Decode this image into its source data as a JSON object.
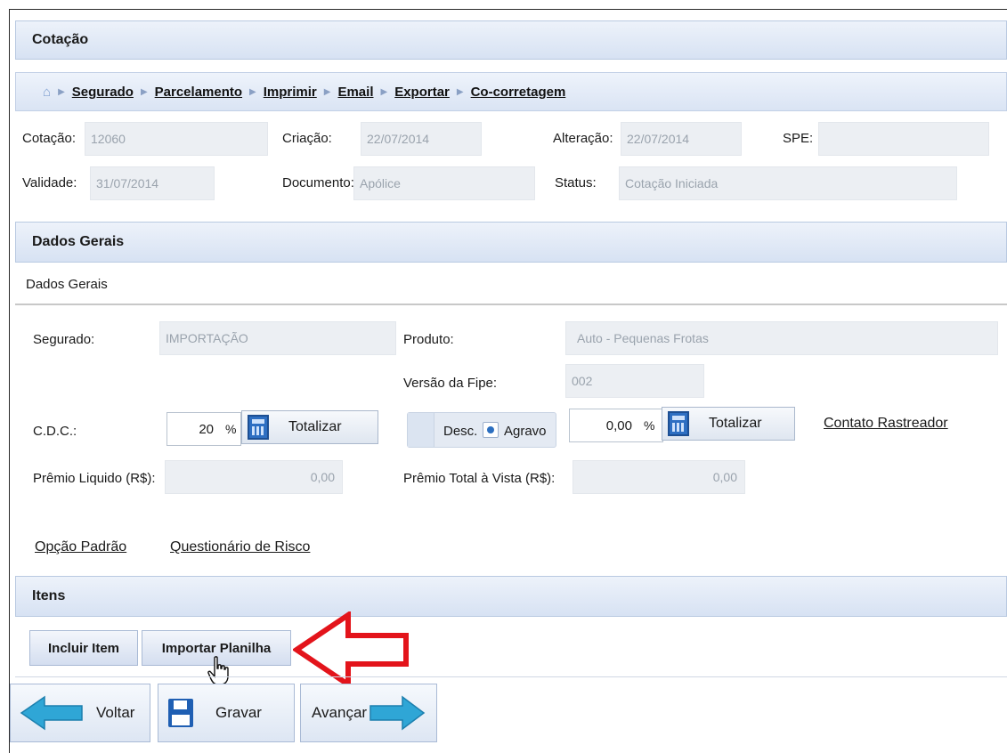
{
  "cotacao_section": {
    "title": "Cotação"
  },
  "breadcrumb": {
    "items": [
      "Segurado",
      "Parcelamento",
      "Imprimir",
      "Email",
      "Exportar",
      "Co-corretagem"
    ]
  },
  "summary": {
    "cotacao_label": "Cotação:",
    "cotacao_value": "12060",
    "criacao_label": "Criação:",
    "criacao_value": "22/07/2014",
    "alteracao_label": "Alteração:",
    "alteracao_value": "22/07/2014",
    "spe_label": "SPE:",
    "spe_value": "",
    "validade_label": "Validade:",
    "validade_value": "31/07/2014",
    "documento_label": "Documento:",
    "documento_value": "Apólice",
    "status_label": "Status:",
    "status_value": "Cotação Iniciada"
  },
  "dados_gerais": {
    "title": "Dados Gerais",
    "subtitle": "Dados Gerais",
    "segurado_label": "Segurado:",
    "segurado_value": "IMPORTAÇÃO",
    "produto_label": "Produto:",
    "produto_value": "Auto - Pequenas Frotas",
    "fipe_label": "Versão da Fipe:",
    "fipe_value": "002",
    "cdc_label": "C.D.C.:",
    "cdc_value": "20",
    "cdc_unit": "%",
    "totalizar_1": "Totalizar",
    "desc_label": "Desc.",
    "agravo_label": "Agravo",
    "agravo_value": "0,00",
    "agravo_unit": "%",
    "totalizar_2": "Totalizar",
    "contato_link": "Contato Rastreador",
    "premio_liquido_label": "Prêmio Liquido (R$):",
    "premio_liquido_value": "0,00",
    "premio_total_label": "Prêmio Total à Vista (R$):",
    "premio_total_value": "0,00",
    "opcao_padrao_link": "Opção Padrão",
    "questionario_link": "Questionário de Risco"
  },
  "itens": {
    "title": "Itens",
    "incluir_button": "Incluir Item",
    "importar_button": "Importar Planilha"
  },
  "footer": {
    "voltar": "Voltar",
    "gravar": "Gravar",
    "avancar": "Avançar"
  },
  "colors": {
    "header_bg": "#d7e2f3",
    "field_bg": "#eceff3",
    "arrow_red": "#e3141b",
    "nav_arrow": "#2fa6d6"
  }
}
